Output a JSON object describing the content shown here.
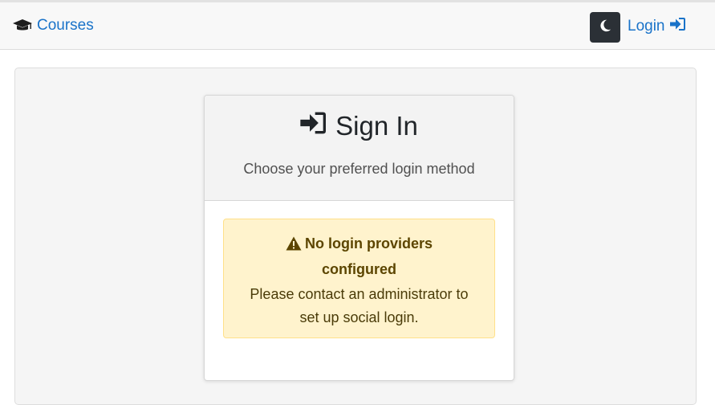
{
  "navbar": {
    "brand_label": "Courses",
    "brand_icon": "graduation-cap-icon",
    "theme_toggle_icon": "moon-icon",
    "login_label": "Login",
    "login_icon": "sign-in-icon",
    "accent_color": "#1a73c9"
  },
  "signin": {
    "title": "Sign In",
    "title_icon": "sign-in-icon",
    "subtitle": "Choose your preferred login method",
    "alert": {
      "icon": "warning-icon",
      "heading": "No login providers configured",
      "body": "Please contact an administrator to set up social login.",
      "background": "#fff3cd"
    }
  }
}
